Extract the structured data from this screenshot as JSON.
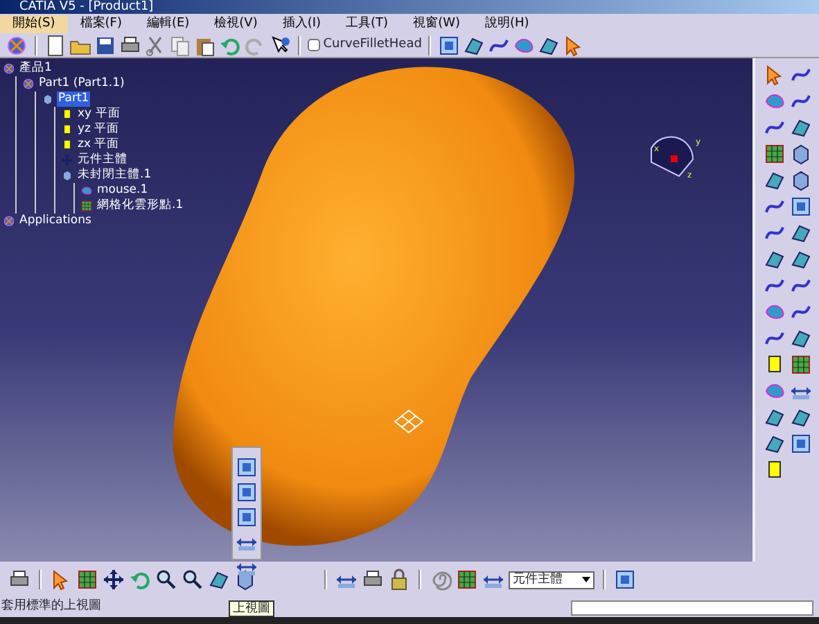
{
  "window": {
    "title": "CATIA V5 - [Product1]"
  },
  "menu": [
    {
      "label": "開始(S)",
      "selected": true
    },
    {
      "label": "檔案(F)",
      "selected": false
    },
    {
      "label": "編輯(E)",
      "selected": false
    },
    {
      "label": "檢視(V)",
      "selected": false
    },
    {
      "label": "插入(I)",
      "selected": false
    },
    {
      "label": "工具(T)",
      "selected": false
    },
    {
      "label": "視窗(W)",
      "selected": false
    },
    {
      "label": "說明(H)",
      "selected": false
    }
  ],
  "toolbar": {
    "checkbox": {
      "label": "CurveFilletHead",
      "checked": false
    }
  },
  "tree": [
    {
      "label": "產品1",
      "selected": false,
      "children": [
        {
          "label": "Part1 (Part1.1)",
          "selected": false,
          "children": [
            {
              "label": "Part1",
              "selected": true,
              "children": [
                {
                  "label": "xy 平面",
                  "selected": false
                },
                {
                  "label": "yz 平面",
                  "selected": false
                },
                {
                  "label": "zx 平面",
                  "selected": false
                },
                {
                  "label": "元件主體",
                  "selected": false
                },
                {
                  "label": "未封閉主體.1",
                  "selected": false,
                  "children": [
                    {
                      "label": "mouse.1",
                      "selected": false
                    },
                    {
                      "label": "網格化雲形點.1",
                      "selected": false
                    }
                  ]
                }
              ]
            }
          ]
        }
      ]
    },
    {
      "label": "Applications",
      "selected": false
    }
  ],
  "compass": {
    "labels": [
      "x",
      "y",
      "z"
    ]
  },
  "bottom_toolbar": {
    "combo": {
      "value": "元件主體"
    }
  },
  "tooltip": "上視圖",
  "status_bar": {
    "message": "套用標準的上視圖"
  }
}
